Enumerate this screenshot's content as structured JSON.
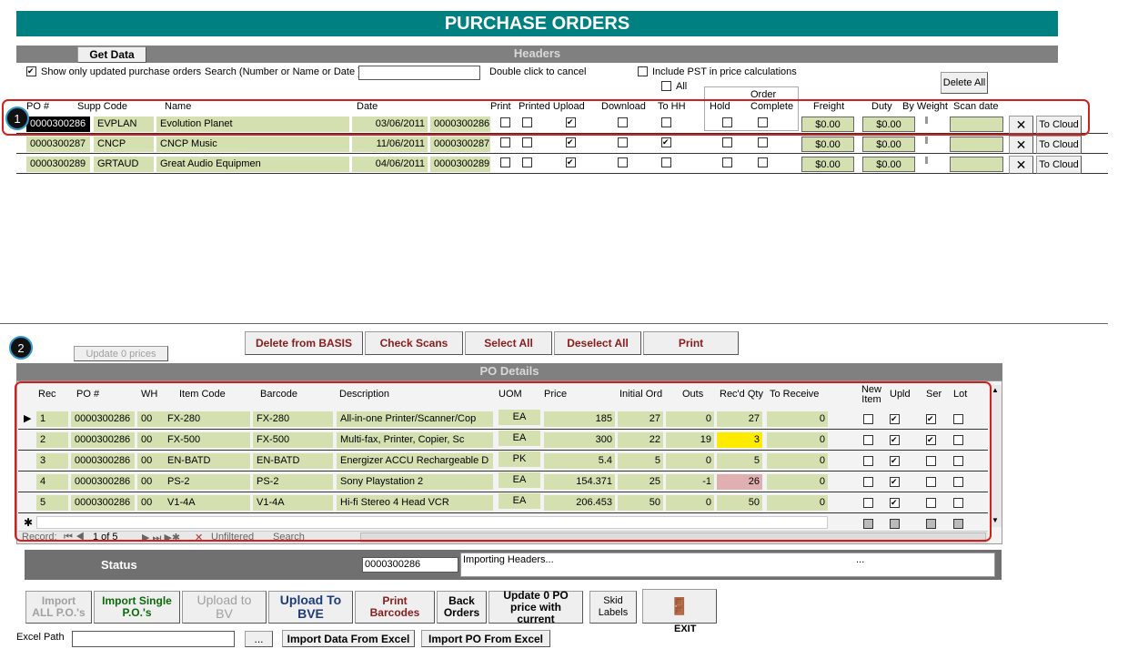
{
  "title": "PURCHASE ORDERS",
  "headers_bar": "Headers",
  "get_data": "Get Data",
  "show_only_updated": "Show only updated purchase orders",
  "search_label": "Search (Number or Name or Date )",
  "double_click": "Double click to cancel",
  "include_pst": "Include PST in price calculations",
  "all_label": "All",
  "delete_all": "Delete All",
  "order_label": "Order",
  "header_cols": {
    "po": "PO #",
    "supp": "Supp Code",
    "name": "Name",
    "date": "Date",
    "print": "Print",
    "printed_upload": "Printed Upload",
    "download": "Download",
    "to_hh": "To HH",
    "hold": "Hold",
    "complete": "Complete",
    "freight": "Freight",
    "duty": "Duty",
    "by_weight": "By Weight",
    "scan_date": "Scan date"
  },
  "header_rows": [
    {
      "po": "0000300286",
      "supp": "EVPLAN",
      "name": "Evolution Planet",
      "date": "03/06/2011",
      "ref": "0000300286",
      "freight": "$0.00",
      "duty": "$0.00",
      "cloud": "To Cloud"
    },
    {
      "po": "0000300287",
      "supp": "CNCP",
      "name": "CNCP Music",
      "date": "11/06/2011",
      "ref": "0000300287",
      "freight": "$0.00",
      "duty": "$0.00",
      "cloud": "To Cloud"
    },
    {
      "po": "0000300289",
      "supp": "GRTAUD",
      "name": "Great Audio Equipmen",
      "date": "04/06/2011",
      "ref": "0000300289",
      "freight": "$0.00",
      "duty": "$0.00",
      "cloud": "To Cloud"
    }
  ],
  "badge1": "1",
  "badge2": "2",
  "update_prices": "Update 0 prices",
  "actions": {
    "delete_basis": "Delete from BASIS",
    "check_scans": "Check Scans",
    "select_all": "Select All",
    "deselect_all": "Deselect All",
    "print": "Print"
  },
  "details_bar": "PO Details",
  "detail_cols": {
    "rec": "Rec",
    "po": "PO #",
    "wh": "WH",
    "item": "Item Code",
    "barcode": "Barcode",
    "desc": "Description",
    "uom": "UOM",
    "price": "Price",
    "initial": "Initial Ord",
    "outs": "Outs",
    "recd": "Rec'd Qty",
    "to_receive": "To Receive",
    "new_item": "New Item",
    "upld": "Upld",
    "ser": "Ser",
    "lot": "Lot"
  },
  "detail_rows": [
    {
      "rec": "1",
      "po": "0000300286",
      "wh": "00",
      "item": "FX-280",
      "barcode": "FX-280",
      "desc": "All-in-one Printer/Scanner/Cop",
      "uom": "EA",
      "price": "185",
      "initial": "27",
      "outs": "0",
      "recd": "27",
      "to_receive": "0"
    },
    {
      "rec": "2",
      "po": "0000300286",
      "wh": "00",
      "item": "FX-500",
      "barcode": "FX-500",
      "desc": "Multi-fax, Printer, Copier, Sc",
      "uom": "EA",
      "price": "300",
      "initial": "22",
      "outs": "19",
      "recd": "3",
      "to_receive": "0"
    },
    {
      "rec": "3",
      "po": "0000300286",
      "wh": "00",
      "item": "EN-BATD",
      "barcode": "EN-BATD",
      "desc": "Energizer ACCU Rechargeable D",
      "uom": "PK",
      "price": "5.4",
      "initial": "5",
      "outs": "0",
      "recd": "5",
      "to_receive": "0"
    },
    {
      "rec": "4",
      "po": "0000300286",
      "wh": "00",
      "item": "PS-2",
      "barcode": "PS-2",
      "desc": "Sony Playstation 2",
      "uom": "EA",
      "price": "154.371",
      "initial": "25",
      "outs": "-1",
      "recd": "26",
      "to_receive": "0"
    },
    {
      "rec": "5",
      "po": "0000300286",
      "wh": "00",
      "item": "V1-4A",
      "barcode": "V1-4A",
      "desc": "Hi-fi Stereo 4 Head VCR",
      "uom": "EA",
      "price": "206.453",
      "initial": "50",
      "outs": "0",
      "recd": "50",
      "to_receive": "0"
    }
  ],
  "record_nav": {
    "label": "Record:",
    "position": "1 of 5",
    "filter": "Unfiltered",
    "search": "Search"
  },
  "status_label": "Status",
  "status_po": "0000300286",
  "status_message": "Importing Headers...",
  "status_dots": "...",
  "bottom": {
    "import_all": "Import ALL P.O.'s",
    "import_single": "Import Single P.O.'s",
    "upload_bv": "Upload to BV",
    "upload_bve": "Upload To BVE",
    "print_barcodes": "Print Barcodes",
    "back_orders": "Back Orders",
    "update_po": "Update 0 PO price with current",
    "skid_labels": "Skid Labels",
    "exit": "EXIT"
  },
  "excel_path_label": "Excel Path",
  "browse": "...",
  "import_data_excel": "Import Data From Excel",
  "import_po_excel": "Import PO From Excel"
}
